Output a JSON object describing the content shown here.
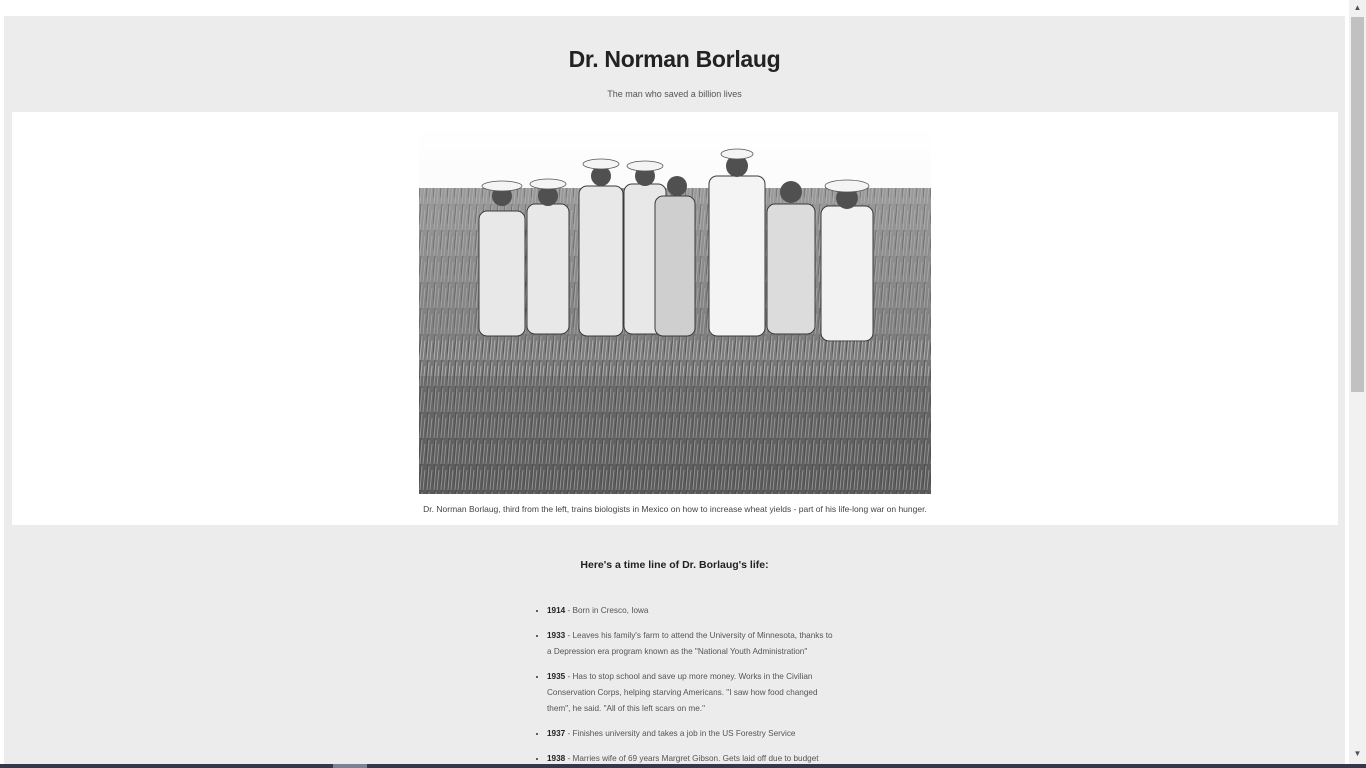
{
  "header": {
    "title": "Dr. Norman Borlaug",
    "subtitle": "The man who saved a billion lives"
  },
  "image": {
    "caption": "Dr. Norman Borlaug, third from the left, trains biologists in Mexico on how to increase wheat yields - part of his life-long war on hunger."
  },
  "timeline": {
    "heading": "Here's a time line of Dr. Borlaug's life:",
    "items": [
      {
        "year": "1914",
        "text": " - Born in Cresco, Iowa"
      },
      {
        "year": "1933",
        "text": " - Leaves his family's farm to attend the University of Minnesota, thanks to a Depression era program known as the \"National Youth Administration\""
      },
      {
        "year": "1935",
        "text": " - Has to stop school and save up more money. Works in the Civilian Conservation Corps, helping starving Americans. \"I saw how food changed them\", he said. \"All of this left scars on me.\""
      },
      {
        "year": "1937",
        "text": " - Finishes university and takes a job in the US Forestry Service"
      },
      {
        "year": "1938",
        "text": " - Marries wife of 69 years Margret Gibson. Gets laid off due to budget"
      }
    ]
  },
  "scrollbar": {
    "up_arrow": "▲",
    "down_arrow": "▼",
    "position": 0.0
  }
}
